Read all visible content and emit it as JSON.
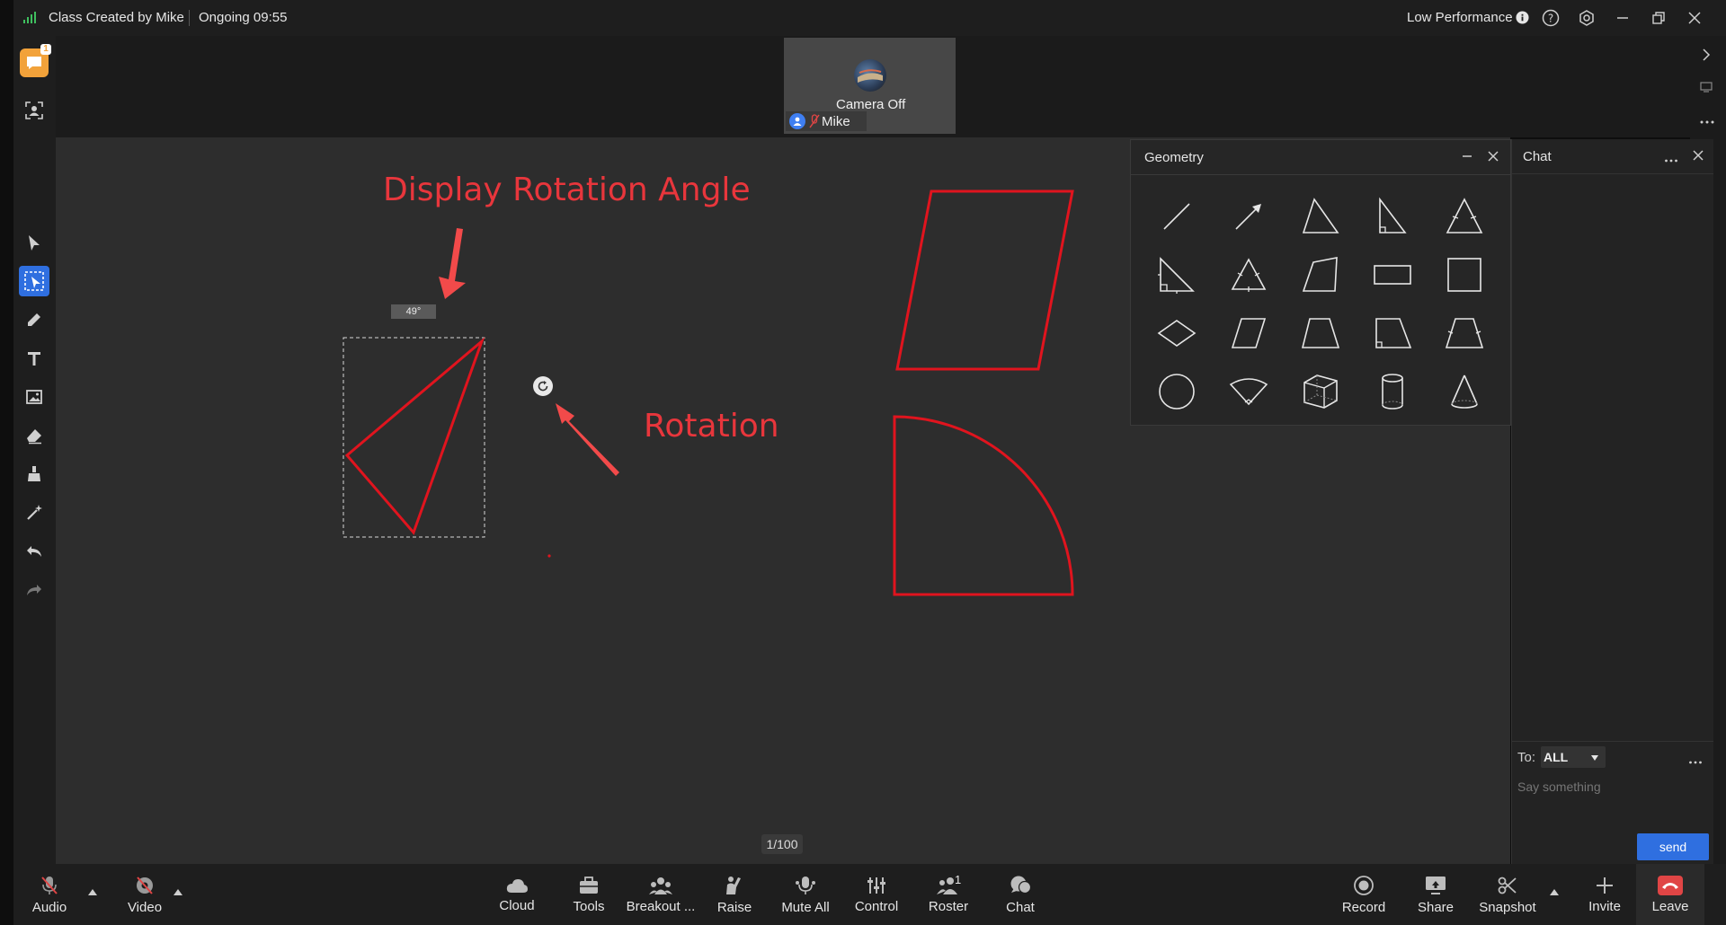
{
  "titlebar": {
    "class_title": "Class Created by Mike",
    "status": "Ongoing 09:55",
    "performance": "Low Performance"
  },
  "video": {
    "camera_status": "Camera Off",
    "participant": "Mike"
  },
  "left_tools": {
    "chat_badge": "1"
  },
  "canvas": {
    "angle_badge": "49°",
    "annotation_angle": "Display Rotation Angle",
    "annotation_rotation": "Rotation",
    "page_indicator": "1/100"
  },
  "geometry": {
    "title": "Geometry",
    "shapes": [
      "line-icon",
      "arrow-icon",
      "triangle-icon",
      "right-triangle-icon",
      "isosceles-triangle-icon",
      "right-triangle-marked-icon",
      "equilateral-triangle-icon",
      "quadrilateral-icon",
      "rectangle-icon",
      "square-icon",
      "rhombus-icon",
      "parallelogram-icon",
      "trapezoid-icon",
      "right-trapezoid-icon",
      "isosceles-trapezoid-icon",
      "circle-icon",
      "sector-icon",
      "cube-icon",
      "cylinder-icon",
      "cone-icon"
    ]
  },
  "chat": {
    "title": "Chat",
    "to_label": "To:",
    "to_value": "ALL",
    "placeholder": "Say something",
    "send": "send"
  },
  "bottombar": {
    "audio": "Audio",
    "video": "Video",
    "cloud": "Cloud",
    "tools": "Tools",
    "breakout": "Breakout ...",
    "raise": "Raise",
    "mute_all": "Mute All",
    "control": "Control",
    "roster": "Roster",
    "roster_count": "1",
    "chat": "Chat",
    "record": "Record",
    "share": "Share",
    "snapshot": "Snapshot",
    "invite": "Invite",
    "leave": "Leave"
  },
  "colors": {
    "accent": "#2f6fe0",
    "annotation": "#e8363c",
    "shape_stroke": "#e0141e",
    "leave": "#e04545"
  }
}
